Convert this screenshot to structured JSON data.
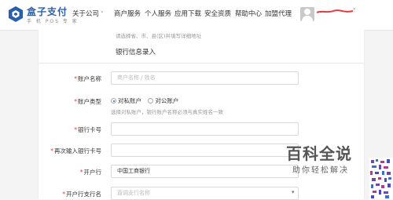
{
  "header": {
    "brand": {
      "name": "盒子支付",
      "tagline": "手 机 POS 专 家"
    },
    "nav": [
      {
        "label": "关于公司",
        "has_dropdown": true
      },
      {
        "label": "商户服务",
        "has_dropdown": false
      },
      {
        "label": "个人服务",
        "has_dropdown": false
      },
      {
        "label": "应用下载",
        "has_dropdown": false
      },
      {
        "label": "安全资质",
        "has_dropdown": false
      },
      {
        "label": "帮助中心",
        "has_dropdown": false
      },
      {
        "label": "加盟代理",
        "has_dropdown": false
      }
    ],
    "account_chevron": "˅"
  },
  "form": {
    "address_hint": "请选择省、市、县(区)并填写详细地址",
    "section_title": "银行信息录入",
    "required_mark": "*",
    "fields": {
      "account_name": {
        "label": "账户名称",
        "placeholder": "商户名称 / 姓名"
      },
      "account_type": {
        "label": "账户类型",
        "options": [
          "对私账户",
          "对公账户"
        ],
        "selected": "对私账户",
        "note": "选择对私账户，银行账户名称必须与真实姓名一致"
      },
      "card_number": {
        "label": "银行卡号",
        "value": ""
      },
      "card_number_confirm": {
        "label": "再次输入银行卡号",
        "value": ""
      },
      "bank": {
        "label": "开户行",
        "value": "中国工商银行"
      },
      "branch": {
        "label": "开户行支行名",
        "placeholder": "直调支行名称"
      }
    }
  },
  "watermark": {
    "title": "百科全说",
    "subtitle": "助你轻松解决"
  },
  "colors": {
    "brand": "#2a5fae",
    "required": "#e23d3d",
    "scribble": "#e8383d"
  }
}
